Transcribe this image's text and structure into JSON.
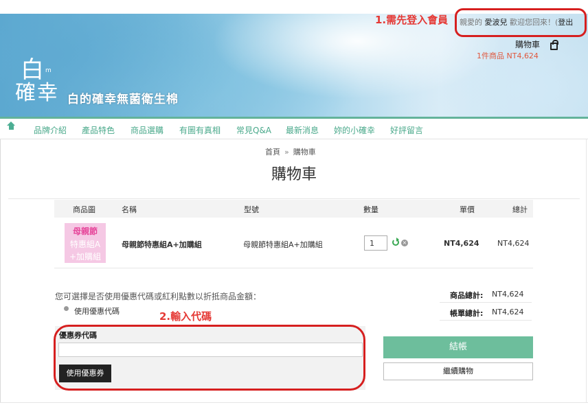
{
  "annotations": {
    "step1": "1.需先登入會員",
    "step2": "2.輸入代碼"
  },
  "header": {
    "welcome_prefix": "親愛的",
    "username": "愛波兒",
    "welcome_suffix": "歡迎您回來！(",
    "logout": "登出",
    "cart_title": "購物車",
    "cart_summary": "1件商品 NT4,624",
    "logo": {
      "bai": "白",
      "m": "m",
      "quexing": "確幸",
      "tagline": "白的確幸無菌衛生棉"
    }
  },
  "nav": {
    "items": [
      "品牌介紹",
      "產品特色",
      "商品選購",
      "有圖有真相",
      "常見Q&A",
      "最新消息",
      "妳的小確幸",
      "好評留言"
    ]
  },
  "breadcrumb": {
    "home": "首頁",
    "separator": "»",
    "current": "購物車"
  },
  "page_title": "購物車",
  "table": {
    "headers": {
      "image": "商品圖",
      "name": "名稱",
      "model": "型號",
      "qty": "數量",
      "unit_price": "單價",
      "total": "總計"
    },
    "rows": [
      {
        "image_text": [
          "母親節",
          "特惠組A",
          "+加購組"
        ],
        "name": "母親節特惠組A+加購組",
        "model": "母親節特惠組A+加購組",
        "qty": "1",
        "unit_price": "NT4,624",
        "total": "NT4,624"
      }
    ]
  },
  "coupon": {
    "description": "您可選擇是否使用優惠代碼或紅利點數以折抵商品金額：",
    "radio_label": "使用優惠代碼",
    "field_label": "優惠券代碼",
    "input_value": "",
    "apply_button": "使用優惠券"
  },
  "totals": {
    "subtotal_label": "商品總計:",
    "subtotal_value": "NT4,624",
    "order_total_label": "帳單總計:",
    "order_total_value": "NT4,624"
  },
  "actions": {
    "checkout": "結帳",
    "continue_shopping": "繼續購物"
  },
  "colors": {
    "accent": "#6dbe9c",
    "nav_text": "#4aa98b",
    "annotation": "#d61f1f",
    "price_highlight": "#e0573d"
  }
}
